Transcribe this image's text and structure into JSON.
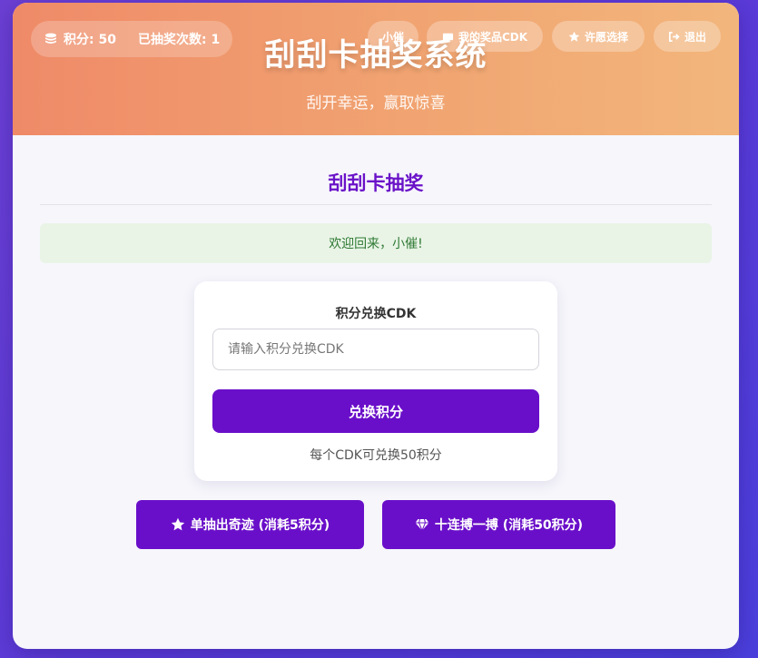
{
  "header": {
    "title": "刮刮卡抽奖系统",
    "subtitle": "刮开幸运，赢取惊喜",
    "points_label": "积分: 50",
    "draws_label": "已抽奖次数: 1"
  },
  "nav": {
    "user": "小催",
    "prizes": "我的奖品CDK",
    "wish": "许愿选择",
    "logout": "退出"
  },
  "main": {
    "section_title": "刮刮卡抽奖",
    "welcome": "欢迎回来，小催!"
  },
  "cdk": {
    "title": "积分兑换CDK",
    "placeholder": "请输入积分兑换CDK",
    "value": "",
    "button": "兑换积分",
    "note": "每个CDK可兑换50积分"
  },
  "draw": {
    "single": "单抽出奇迹 (消耗5积分)",
    "ten": "十连搏一搏 (消耗50积分)"
  },
  "colors": {
    "accent": "#6a0fc9",
    "header_start": "#ef8a68",
    "header_end": "#f2b67c",
    "welcome_bg": "#e9f4e6",
    "welcome_text": "#2f7a34"
  }
}
